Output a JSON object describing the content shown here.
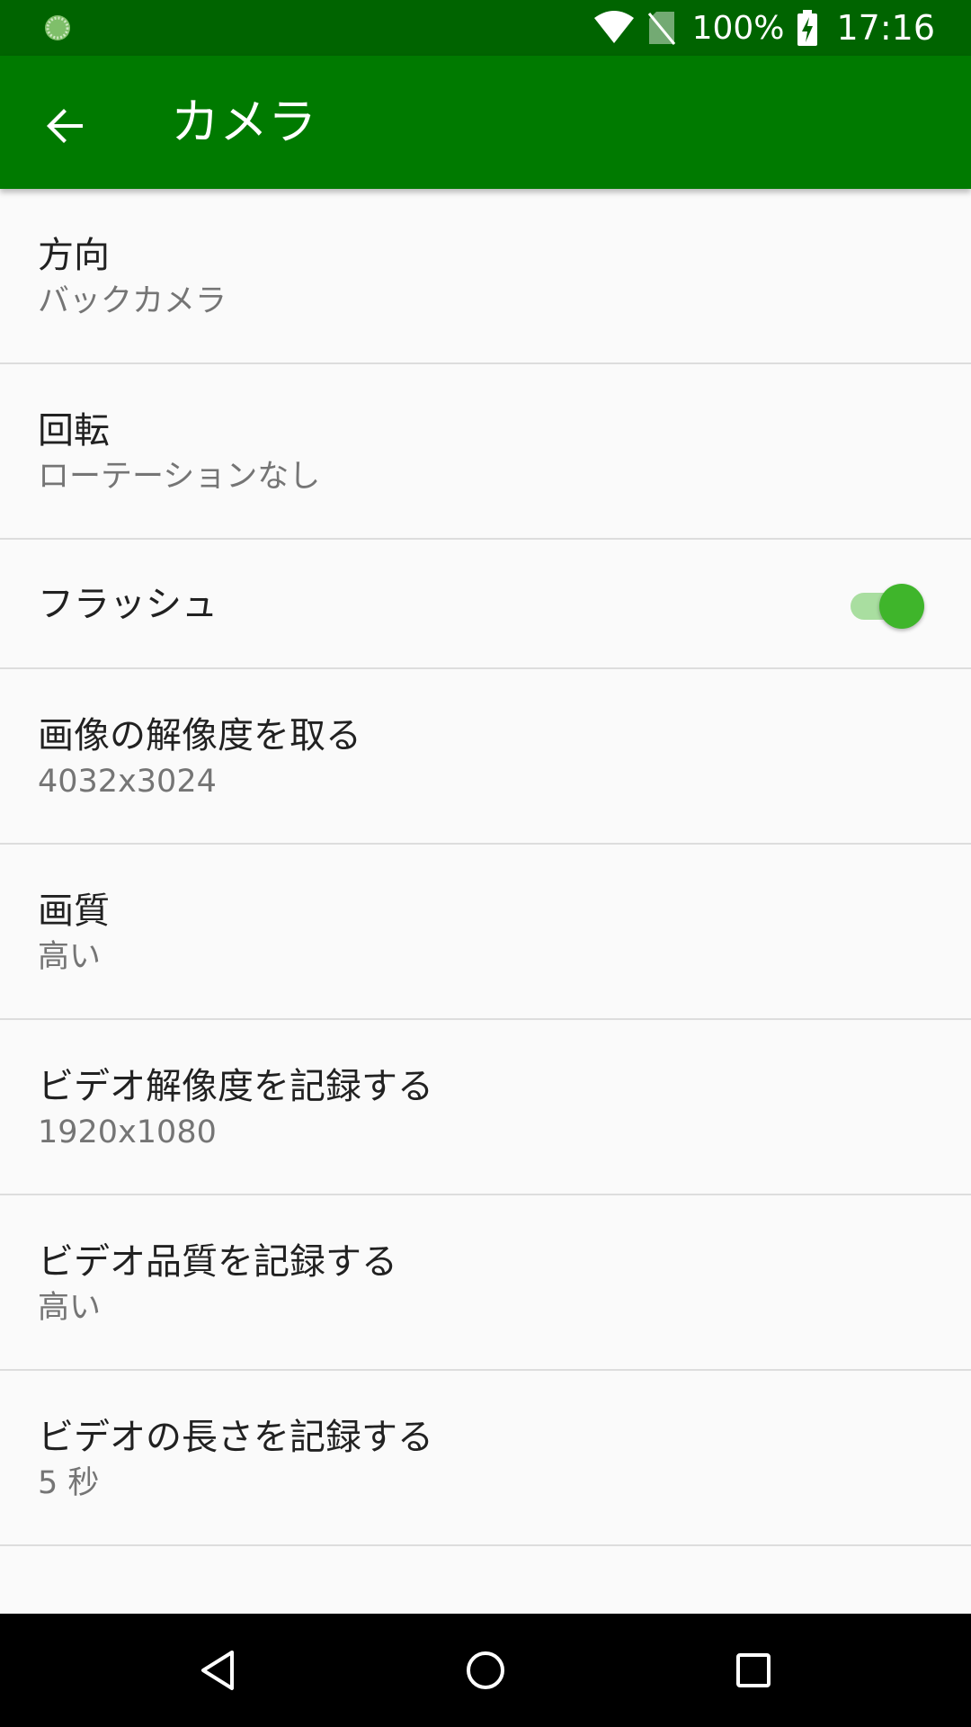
{
  "status_bar": {
    "battery_percent": "100%",
    "time": "17:16"
  },
  "app_bar": {
    "title": "カメラ",
    "back_icon": "arrow-back-icon"
  },
  "settings": {
    "items": [
      {
        "title": "方向",
        "summary": "バックカメラ"
      },
      {
        "title": "回転",
        "summary": "ローテーションなし"
      },
      {
        "title": "フラッシュ",
        "toggle_on": true
      },
      {
        "title": "画像の解像度を取る",
        "summary": "4032x3024"
      },
      {
        "title": "画質",
        "summary": "高い"
      },
      {
        "title": "ビデオ解像度を記録する",
        "summary": "1920x1080"
      },
      {
        "title": "ビデオ品質を記録する",
        "summary": "高い"
      },
      {
        "title": "ビデオの長さを記録する",
        "summary": "5 秒"
      }
    ]
  },
  "nav_bar": {
    "icons": [
      "nav-back-icon",
      "nav-home-icon",
      "nav-recents-icon"
    ]
  },
  "colors": {
    "status_bar": "#006400",
    "app_bar": "#007a00",
    "toggle_thumb": "#3fb52b",
    "toggle_track": "#a9dea0",
    "background": "#fafafa"
  }
}
